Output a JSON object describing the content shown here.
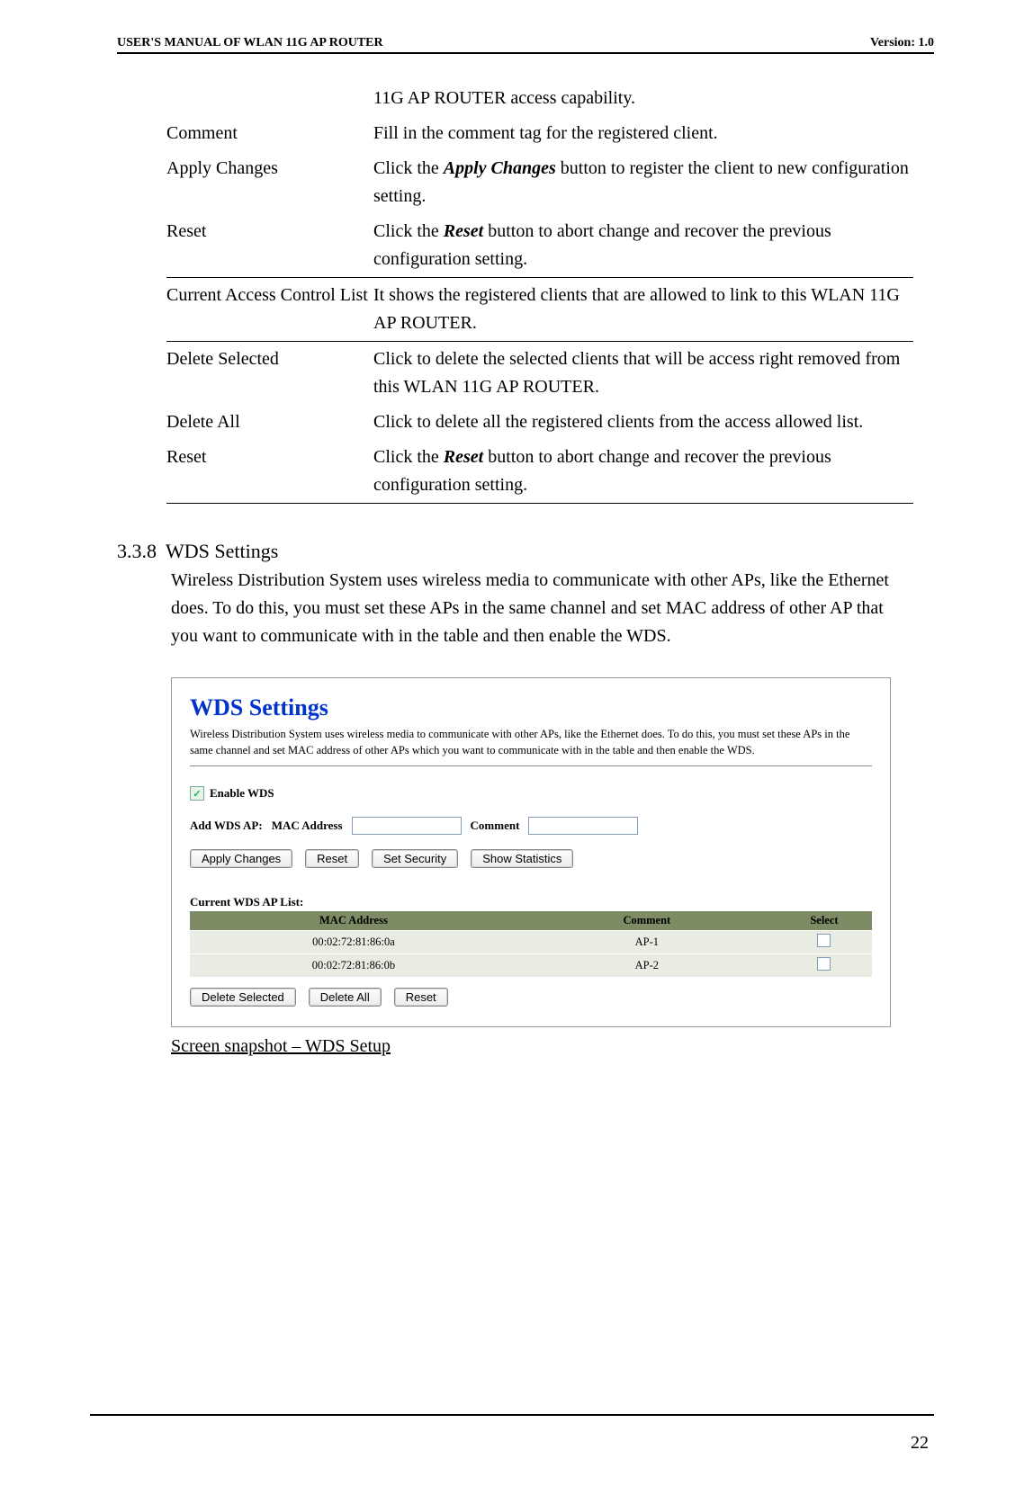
{
  "header": {
    "left": "USER'S MANUAL OF WLAN 11G AP ROUTER",
    "right": "Version: 1.0"
  },
  "defs": {
    "rows": [
      {
        "label": "",
        "text": "11G AP ROUTER access capability.",
        "sep": false
      },
      {
        "label": "Comment",
        "text": "Fill in the comment tag for the registered client.",
        "sep": false
      },
      {
        "label": "Apply Changes",
        "html": "Click the <b><i>Apply Changes</i></b> button to register the client to new configuration setting.",
        "sep": false
      },
      {
        "label": "Reset",
        "html": "Click the <b><i>Reset</i></b> button to abort change and recover the previous configuration setting.",
        "sep": true
      },
      {
        "label": "Current Access Control List",
        "text": "It shows the registered clients that are allowed to link to this WLAN 11G AP ROUTER.",
        "sep": true
      },
      {
        "label": "Delete Selected",
        "text": "Click to delete the selected clients that will be access right removed from this WLAN 11G AP ROUTER.",
        "sep": false
      },
      {
        "label": "Delete All",
        "text": "Click to delete all the registered clients from the access allowed list.",
        "sep": false
      },
      {
        "label": "Reset",
        "html": "Click the <b><i>Reset</i></b> button to abort change and recover the previous configuration setting.",
        "sep": true
      }
    ]
  },
  "section": {
    "num": "3.3.8",
    "title": "WDS Settings",
    "body": "Wireless Distribution System uses wireless media to communicate with other APs, like the Ethernet does. To do this, you must set these APs in the same channel and set MAC address of other AP that you want to communicate with in the table and then enable the WDS."
  },
  "panel": {
    "title": "WDS Settings",
    "desc": "Wireless Distribution System uses wireless media to communicate with other APs, like the Ethernet does. To do this, you must set these APs in the same channel and set MAC address of other APs which you want to communicate with in the table and then enable the WDS.",
    "enable_label": "Enable WDS",
    "add_label": "Add WDS AP:",
    "mac_label": "MAC Address",
    "comment_label": "Comment",
    "buttons": {
      "apply": "Apply Changes",
      "reset": "Reset",
      "security": "Set Security",
      "stats": "Show Statistics"
    },
    "list_title": "Current WDS AP List:",
    "cols": {
      "mac": "MAC Address",
      "comment": "Comment",
      "select": "Select"
    },
    "rows": [
      {
        "mac": "00:02:72:81:86:0a",
        "comment": "AP-1"
      },
      {
        "mac": "00:02:72:81:86:0b",
        "comment": "AP-2"
      }
    ],
    "buttons2": {
      "delsel": "Delete Selected",
      "delall": "Delete All",
      "reset": "Reset"
    }
  },
  "caption": "Screen snapshot – WDS Setup",
  "page_number": "22"
}
